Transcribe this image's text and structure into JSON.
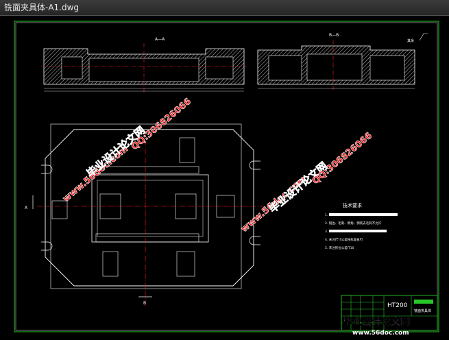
{
  "window": {
    "title": "铣面夹具体-A1.dwg"
  },
  "drawing": {
    "section_aa_label": "A—A",
    "section_bb_label": "B—B",
    "roughness_note": "其余",
    "cut_label_a": "A",
    "cut_label_b": "B",
    "tech_req_title": "技术要求",
    "tech_req_items": [
      "1.",
      "2. 锐边、毛刺、倒角、倒钝去毛刺不允许",
      "3.",
      "4. 未注尺寸公差按标准执行",
      "5. 未注形位公差IT10"
    ],
    "material": "HT200",
    "part_name": "铣面夹具体"
  },
  "watermarks": {
    "site": "www.56doc.com",
    "brand": "毕业设计论文网",
    "qq": "QQ:306826066",
    "footer_brand": "毕业设计论文网",
    "footer_site": "www.56doc.com"
  },
  "colors": {
    "line": "#ffffff",
    "center": "#ff2222",
    "hatch": "#c8c8c8",
    "frame": "#28c828",
    "titleblock": "#28c828",
    "watermark_red": "#ff2020"
  }
}
